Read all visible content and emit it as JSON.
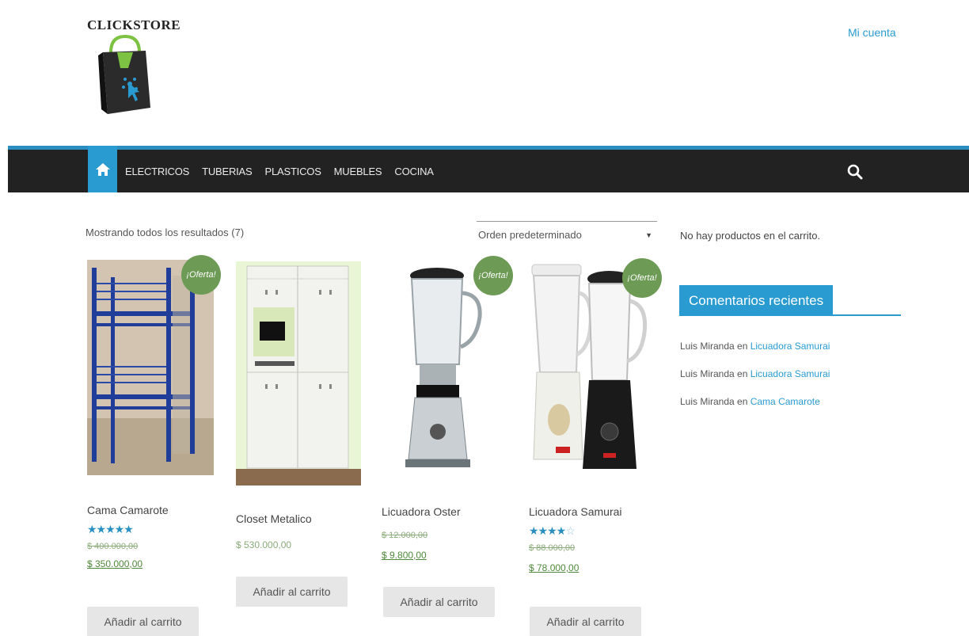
{
  "header": {
    "logo_text": "CLICKSTORE",
    "account_link": "Mi cuenta"
  },
  "nav": {
    "items": [
      "ELECTRICOS",
      "TUBERIAS",
      "PLASTICOS",
      "MUEBLES",
      "COCINA"
    ]
  },
  "shop": {
    "results_count": "Mostrando todos los resultados (7)",
    "orderby_selected": "Orden predeterminado",
    "sale_badge": "¡Oferta!",
    "add_to_cart": "Añadir al carrito"
  },
  "products": [
    {
      "title": "Cama Camarote",
      "rating": 5,
      "on_sale": true,
      "old_price": "$ 400.000,00",
      "price": "$ 350.000,00"
    },
    {
      "title": "Closet Metalico",
      "on_sale": false,
      "price": "$ 530.000,00"
    },
    {
      "title": "Licuadora Oster",
      "on_sale": true,
      "old_price": "$ 12.000,00",
      "price": "$ 9.800,00"
    },
    {
      "title": "Licuadora Samurai",
      "rating": 4,
      "on_sale": true,
      "old_price": "$ 88.000,00",
      "price": "$ 78.000,00"
    }
  ],
  "sidebar": {
    "cart_empty": "No hay productos en el carrito.",
    "recent_comments_title": "Comentarios recientes",
    "comments": [
      {
        "author": "Luis Miranda",
        "connector": " en ",
        "post": "Licuadora Samurai"
      },
      {
        "author": "Luis Miranda",
        "connector": " en ",
        "post": "Licuadora Samurai"
      },
      {
        "author": "Luis Miranda",
        "connector": " en ",
        "post": "Cama Camarote"
      }
    ]
  },
  "colors": {
    "accent": "#2a9bd1",
    "nav_bg": "#222222",
    "sale_badge": "#6d9a55"
  }
}
